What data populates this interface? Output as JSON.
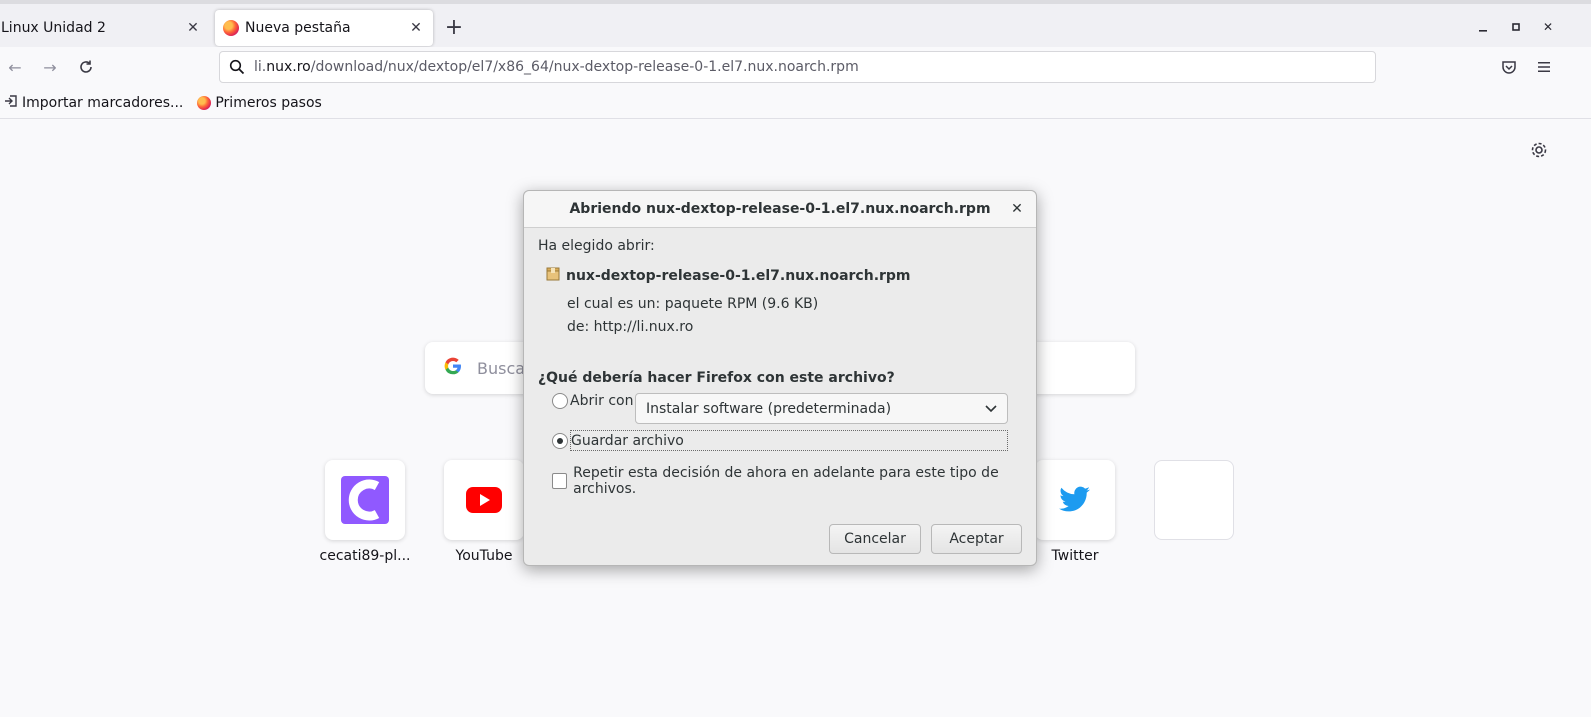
{
  "tabs": [
    {
      "title": "Linux Unidad 2",
      "active": false
    },
    {
      "title": "Nueva pestaña",
      "active": true
    }
  ],
  "urlbar": {
    "prefix": "li.",
    "host": "nux.ro",
    "path": "/download/nux/dextop/el7/x86_64/nux-dextop-release-0-1.el7.nux.noarch.rpm"
  },
  "bookmarks": [
    {
      "label": "Importar marcadores...",
      "icon": "import-icon"
    },
    {
      "label": "Primeros pasos",
      "icon": "firefox-icon"
    }
  ],
  "newtab": {
    "search_placeholder": "Buscar",
    "tiles": [
      {
        "label": "cecati89-pl...",
        "icon": "cecati-icon"
      },
      {
        "label": "YouTube",
        "icon": "youtube-icon"
      },
      {
        "label": "Twitter",
        "icon": "twitter-icon"
      },
      {
        "label": "",
        "icon": "empty-tile"
      }
    ]
  },
  "dialog": {
    "title": "Abriendo nux-dextop-release-0-1.el7.nux.noarch.rpm",
    "chosen_label": "Ha elegido abrir:",
    "file_name": "nux-dextop-release-0-1.el7.nux.noarch.rpm",
    "type_line": "el cual es un: paquete RPM (9.6 KB)",
    "from_line": "de: http://li.nux.ro",
    "question": "¿Qué debería hacer Firefox con este archivo?",
    "open_with_label": "Abrir con",
    "open_with_app": "Instalar software (predeterminada)",
    "save_label": "Guardar archivo",
    "selected_option": "save",
    "remember_label": "Repetir esta decisión de ahora en adelante para este tipo de archivos.",
    "remember_checked": false,
    "cancel_label": "Cancelar",
    "accept_label": "Aceptar"
  },
  "colors": {
    "youtube": "#ff0000",
    "twitter": "#1d9bf0",
    "cecati": "#9059ff"
  }
}
